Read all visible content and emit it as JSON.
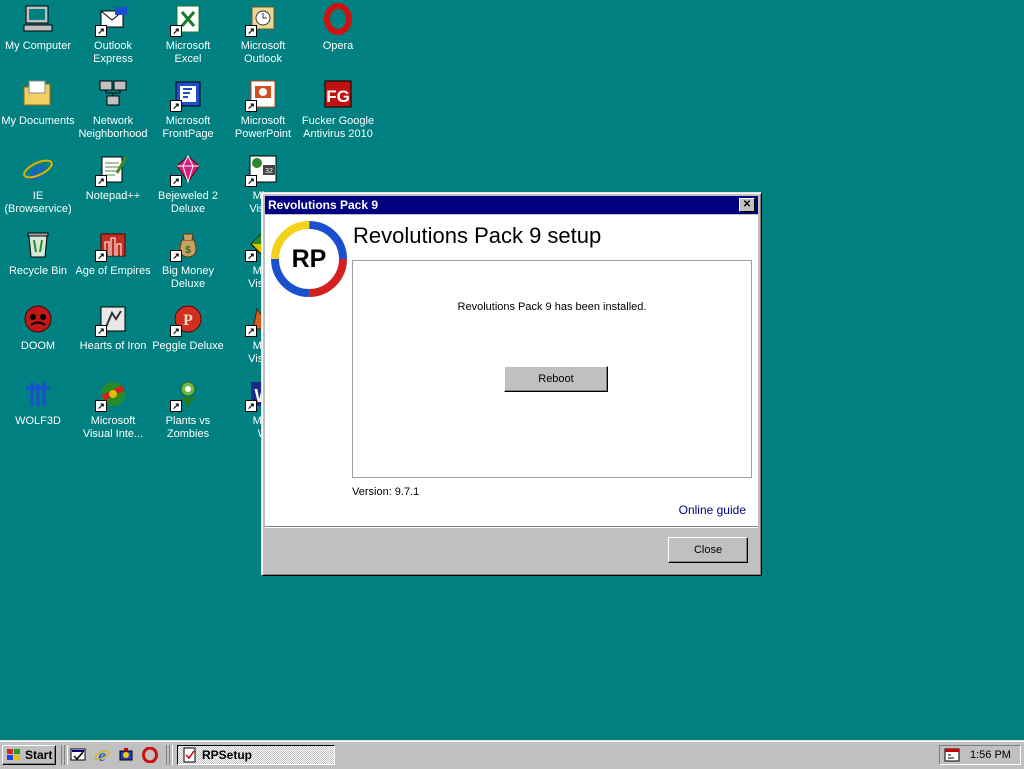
{
  "desktop": {
    "icons": [
      {
        "label": "My Computer",
        "icon": "computer-icon",
        "shortcut": false
      },
      {
        "label": "Outlook\nExpress",
        "icon": "outlook-express-icon",
        "shortcut": true
      },
      {
        "label": "Microsoft\nExcel",
        "icon": "excel-icon",
        "shortcut": true
      },
      {
        "label": "Microsoft\nOutlook",
        "icon": "outlook-icon",
        "shortcut": true
      },
      {
        "label": "Opera",
        "icon": "opera-icon",
        "shortcut": false
      },
      {
        "label": "My Documents",
        "icon": "folder-icon",
        "shortcut": false
      },
      {
        "label": "Network\nNeighborhood",
        "icon": "network-icon",
        "shortcut": false
      },
      {
        "label": "Microsoft\nFrontPage",
        "icon": "frontpage-icon",
        "shortcut": true
      },
      {
        "label": "Microsoft\nPowerPoint",
        "icon": "powerpoint-icon",
        "shortcut": true
      },
      {
        "label": "Fucker Google\nAntivirus 2010",
        "icon": "antivirus-icon",
        "shortcut": false
      },
      {
        "label": "IE\n(Browservice)",
        "icon": "ie-icon",
        "shortcut": false
      },
      {
        "label": "Notepad++",
        "icon": "notepad-icon",
        "shortcut": true
      },
      {
        "label": "Bejeweled 2\nDeluxe",
        "icon": "bejeweled-icon",
        "shortcut": true
      },
      {
        "label": "Micr\nVisua",
        "icon": "visual-studio-icon",
        "shortcut": true
      },
      {
        "label": "Recycle Bin",
        "icon": "recycle-bin-icon",
        "shortcut": false
      },
      {
        "label": "Age of Empires",
        "icon": "age-of-empires-icon",
        "shortcut": true
      },
      {
        "label": "Big Money\nDeluxe",
        "icon": "money-bag-icon",
        "shortcut": true
      },
      {
        "label": "Micr\nVisual",
        "icon": "visual-app-icon",
        "shortcut": true
      },
      {
        "label": "DOOM",
        "icon": "doom-icon",
        "shortcut": false
      },
      {
        "label": "Hearts of Iron",
        "icon": "hearts-of-iron-icon",
        "shortcut": true
      },
      {
        "label": "Peggle Deluxe",
        "icon": "peggle-icon",
        "shortcut": true
      },
      {
        "label": "Micr\nVisual",
        "icon": "visual-fox-icon",
        "shortcut": true
      },
      {
        "label": "WOLF3D",
        "icon": "wolf3d-icon",
        "shortcut": false
      },
      {
        "label": "Microsoft\nVisual Inte...",
        "icon": "visual-interdev-icon",
        "shortcut": true
      },
      {
        "label": "Plants vs\nZombies",
        "icon": "plants-vs-zombies-icon",
        "shortcut": true
      },
      {
        "label": "Micr\nW",
        "icon": "visual-w-icon",
        "shortcut": true
      }
    ]
  },
  "dialog": {
    "title": "Revolutions Pack 9",
    "close_glyph": "✕",
    "logo_text": "RP",
    "heading": "Revolutions Pack 9 setup",
    "message": "Revolutions Pack 9 has been installed.",
    "reboot_label": "Reboot",
    "version": "Version: 9.7.1",
    "online_guide": "Online guide",
    "close_label": "Close"
  },
  "taskbar": {
    "start_label": "Start",
    "quick_launch": [
      "desktop-icon",
      "ie-icon",
      "channels-icon",
      "opera-icon"
    ],
    "task_label": "RPSetup",
    "clock": "1:56 PM"
  },
  "colors": {
    "desktop": "#008080",
    "title_bar": "#000080",
    "face": "#c0c0c0"
  }
}
